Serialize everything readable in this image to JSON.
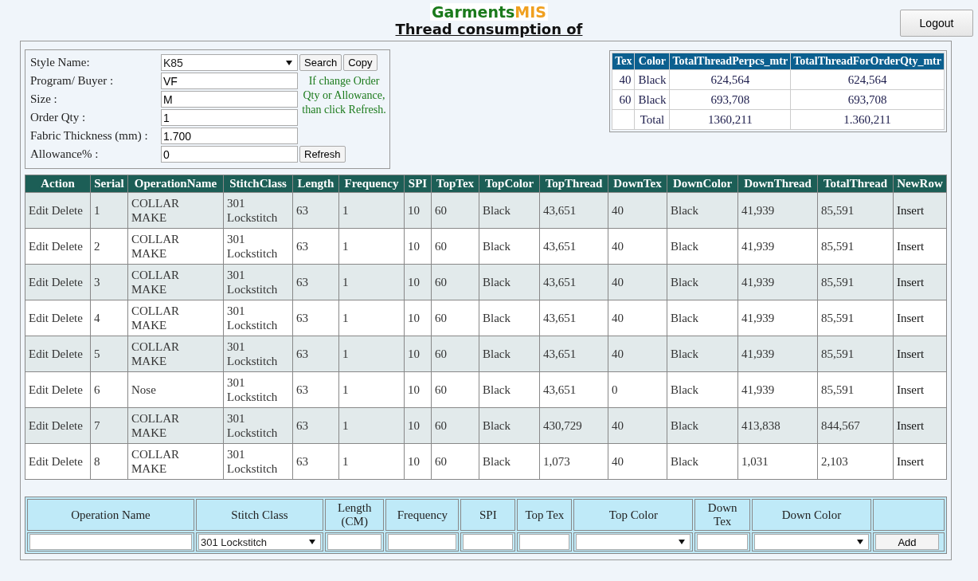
{
  "brand": {
    "first": "Garments",
    "second": "MIS"
  },
  "page_title": "Thread consumption of",
  "logout_button": "Logout",
  "style_form": {
    "fields": [
      {
        "label": "Style Name:",
        "value": "K85",
        "kind": "select"
      },
      {
        "label": "Program/ Buyer :",
        "value": "VF",
        "kind": "text"
      },
      {
        "label": "Size :",
        "value": "M",
        "kind": "text"
      },
      {
        "label": "Order Qty :",
        "value": "1",
        "kind": "text"
      },
      {
        "label": "Fabric Thickness (mm) :",
        "value": "1.700",
        "kind": "text"
      },
      {
        "label": "Allowance% :",
        "value": "0",
        "kind": "text"
      }
    ],
    "search_button": "Search",
    "copy_button": "Copy",
    "refresh_button": "Refresh",
    "note": "If change Order Qty or Allowance, than click Refresh."
  },
  "summary_table": {
    "columns": [
      "Tex",
      "Color",
      "TotalThreadPerpcs_mtr",
      "TotalThreadForOrderQty_mtr"
    ],
    "rows": [
      [
        "40",
        "Black",
        "624,564",
        "624,564"
      ],
      [
        "60",
        "Black",
        "693,708",
        "693,708"
      ],
      [
        "",
        "Total",
        "1360,211",
        "1.360,211"
      ]
    ]
  },
  "operations_table": {
    "columns": [
      "Action",
      "Serial",
      "OperationName",
      "StitchClass",
      "Length",
      "Frequency",
      "SPI",
      "TopTex",
      "TopColor",
      "TopThread",
      "DownTex",
      "DownColor",
      "DownThread",
      "TotalThread",
      "NewRow"
    ],
    "rows": [
      [
        [
          "Edit",
          "Delete"
        ],
        "1",
        "COLLAR MAKE",
        "301 Lockstitch",
        "63",
        "1",
        "10",
        "60",
        "Black",
        "43,651",
        "40",
        "Black",
        "41,939",
        "85,591",
        "Insert"
      ],
      [
        [
          "Edit",
          "Delete"
        ],
        "2",
        "COLLAR MAKE",
        "301 Lockstitch",
        "63",
        "1",
        "10",
        "60",
        "Black",
        "43,651",
        "40",
        "Black",
        "41,939",
        "85,591",
        "Insert"
      ],
      [
        [
          "Edit",
          "Delete"
        ],
        "3",
        "COLLAR MAKE",
        "301 Lockstitch",
        "63",
        "1",
        "10",
        "60",
        "Black",
        "43,651",
        "40",
        "Black",
        "41,939",
        "85,591",
        "Insert"
      ],
      [
        [
          "Edit",
          "Delete"
        ],
        "4",
        "COLLAR MAKE",
        "301 Lockstitch",
        "63",
        "1",
        "10",
        "60",
        "Black",
        "43,651",
        "40",
        "Black",
        "41,939",
        "85,591",
        "Insert"
      ],
      [
        [
          "Edit",
          "Delete"
        ],
        "5",
        "COLLAR MAKE",
        "301 Lockstitch",
        "63",
        "1",
        "10",
        "60",
        "Black",
        "43,651",
        "40",
        "Black",
        "41,939",
        "85,591",
        "Insert"
      ],
      [
        [
          "Edit",
          "Delete"
        ],
        "6",
        "Nose",
        "301 Lockstitch",
        "63",
        "1",
        "10",
        "60",
        "Black",
        "43,651",
        "0",
        "Black",
        "41,939",
        "85,591",
        "Insert"
      ],
      [
        [
          "Edit",
          "Delete"
        ],
        "7",
        "COLLAR MAKE",
        "301 Lockstitch",
        "63",
        "1",
        "10",
        "60",
        "Black",
        "430,729",
        "40",
        "Black",
        "413,838",
        "844,567",
        "Insert"
      ],
      [
        [
          "Edit",
          "Delete"
        ],
        "8",
        "COLLAR MAKE",
        "301 Lockstitch",
        "63",
        "1",
        "10",
        "60",
        "Black",
        "1,073",
        "40",
        "Black",
        "1,031",
        "2,103",
        "Insert"
      ]
    ]
  },
  "add_form": {
    "columns": [
      "Operation Name",
      "Stitch Class",
      "Length (CM)",
      "Frequency",
      "SPI",
      "Top Tex",
      "Top Color",
      "Down Tex",
      "Down Color"
    ],
    "controls": [
      {
        "kind": "text"
      },
      {
        "kind": "select",
        "value": "301 Lockstitch"
      },
      {
        "kind": "text"
      },
      {
        "kind": "text"
      },
      {
        "kind": "text"
      },
      {
        "kind": "text"
      },
      {
        "kind": "select"
      },
      {
        "kind": "text"
      },
      {
        "kind": "select"
      },
      {
        "kind": "button",
        "value": "Add"
      }
    ]
  }
}
